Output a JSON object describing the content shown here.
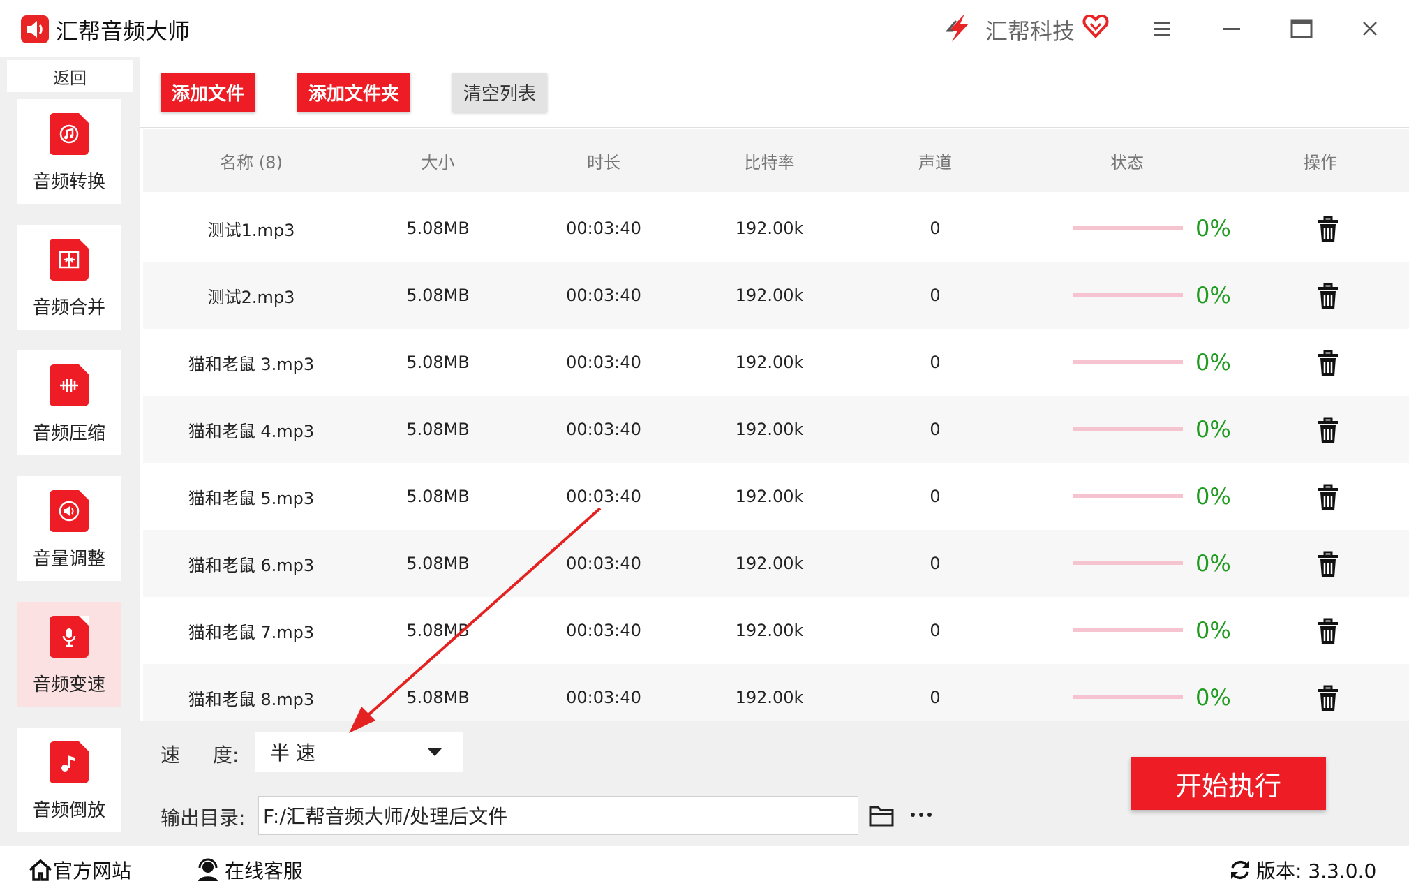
{
  "window": {
    "title": "汇帮音频大师",
    "brand": "汇帮科技"
  },
  "sidebar": {
    "back_label": "返回",
    "items": [
      {
        "label": "音频转换",
        "icon": "audio-convert-icon",
        "active": false
      },
      {
        "label": "音频合并",
        "icon": "audio-merge-icon",
        "active": false
      },
      {
        "label": "音频压缩",
        "icon": "audio-compress-icon",
        "active": false
      },
      {
        "label": "音量调整",
        "icon": "volume-icon",
        "active": false
      },
      {
        "label": "音频变速",
        "icon": "microphone-icon",
        "active": true
      },
      {
        "label": "音频倒放",
        "icon": "music-note-icon",
        "active": false
      }
    ]
  },
  "toolbar": {
    "add_file": "添加文件",
    "add_folder": "添加文件夹",
    "clear_list": "清空列表"
  },
  "table": {
    "headers": [
      "名称 (8)",
      "大小",
      "时长",
      "比特率",
      "声道",
      "状态",
      "操作"
    ],
    "rows": [
      {
        "name": "测试1.mp3",
        "size": "5.08MB",
        "duration": "00:03:40",
        "bitrate": "192.00k",
        "channel": "0",
        "progress": "0%"
      },
      {
        "name": "测试2.mp3",
        "size": "5.08MB",
        "duration": "00:03:40",
        "bitrate": "192.00k",
        "channel": "0",
        "progress": "0%"
      },
      {
        "name": "猫和老鼠 3.mp3",
        "size": "5.08MB",
        "duration": "00:03:40",
        "bitrate": "192.00k",
        "channel": "0",
        "progress": "0%"
      },
      {
        "name": "猫和老鼠 4.mp3",
        "size": "5.08MB",
        "duration": "00:03:40",
        "bitrate": "192.00k",
        "channel": "0",
        "progress": "0%"
      },
      {
        "name": "猫和老鼠 5.mp3",
        "size": "5.08MB",
        "duration": "00:03:40",
        "bitrate": "192.00k",
        "channel": "0",
        "progress": "0%"
      },
      {
        "name": "猫和老鼠 6.mp3",
        "size": "5.08MB",
        "duration": "00:03:40",
        "bitrate": "192.00k",
        "channel": "0",
        "progress": "0%"
      },
      {
        "name": "猫和老鼠 7.mp3",
        "size": "5.08MB",
        "duration": "00:03:40",
        "bitrate": "192.00k",
        "channel": "0",
        "progress": "0%"
      },
      {
        "name": "猫和老鼠 8.mp3",
        "size": "5.08MB",
        "duration": "00:03:40",
        "bitrate": "192.00k",
        "channel": "0",
        "progress": "0%"
      }
    ]
  },
  "settings": {
    "speed_label_1": "速",
    "speed_label_2": "度:",
    "speed_value": "半 速",
    "output_label": "输出目录:",
    "output_path": "F:/汇帮音频大师/处理后文件",
    "start_button": "开始执行"
  },
  "statusbar": {
    "website": "官方网站",
    "support": "在线客服",
    "version": "版本: 3.3.0.0"
  },
  "colors": {
    "accent": "#ee1c24",
    "progress_text": "#1f9c1f",
    "progress_track": "#f6c4d0"
  }
}
